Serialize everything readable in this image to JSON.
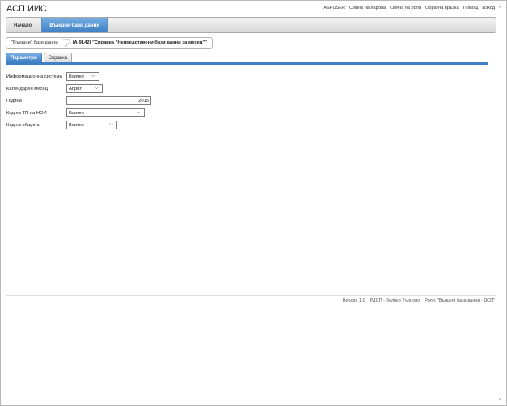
{
  "app": {
    "title": "АСП ИИС"
  },
  "top_links": [
    "ASPUSER",
    "Смяна на парола",
    "Смяна на роля",
    "Обратна връзка",
    "Помощ",
    "Изход"
  ],
  "navbar": {
    "items": [
      {
        "label": "Начало",
        "active": false
      },
      {
        "label": "Външни бази данни",
        "active": true
      }
    ]
  },
  "breadcrumb": {
    "parent": "\"Външни\" бази данни",
    "current": "(А-9142) \"Справка \"Непредставени бази данни за месец\"\""
  },
  "tabs": [
    {
      "label": "Параметри",
      "active": true
    },
    {
      "label": "Справка",
      "active": false
    }
  ],
  "form": {
    "info_system": {
      "label": "Информационна система",
      "value": "Всички"
    },
    "month": {
      "label": "Календарен месец",
      "value": "Април"
    },
    "year": {
      "label": "Година",
      "value": "2015"
    },
    "tp_noi": {
      "label": "Код на ТП на НОИ",
      "value": "Всички"
    },
    "municipality": {
      "label": "Код на община",
      "value": "Всички"
    }
  },
  "footer": {
    "version": "Версия 1.0",
    "office": "РДСП - Велико Търново",
    "role": "Роля: \"Външни бази данни - ДСП\""
  },
  "colors": {
    "accent": "#3f7fc4",
    "tab_active": "#79b0e6"
  }
}
